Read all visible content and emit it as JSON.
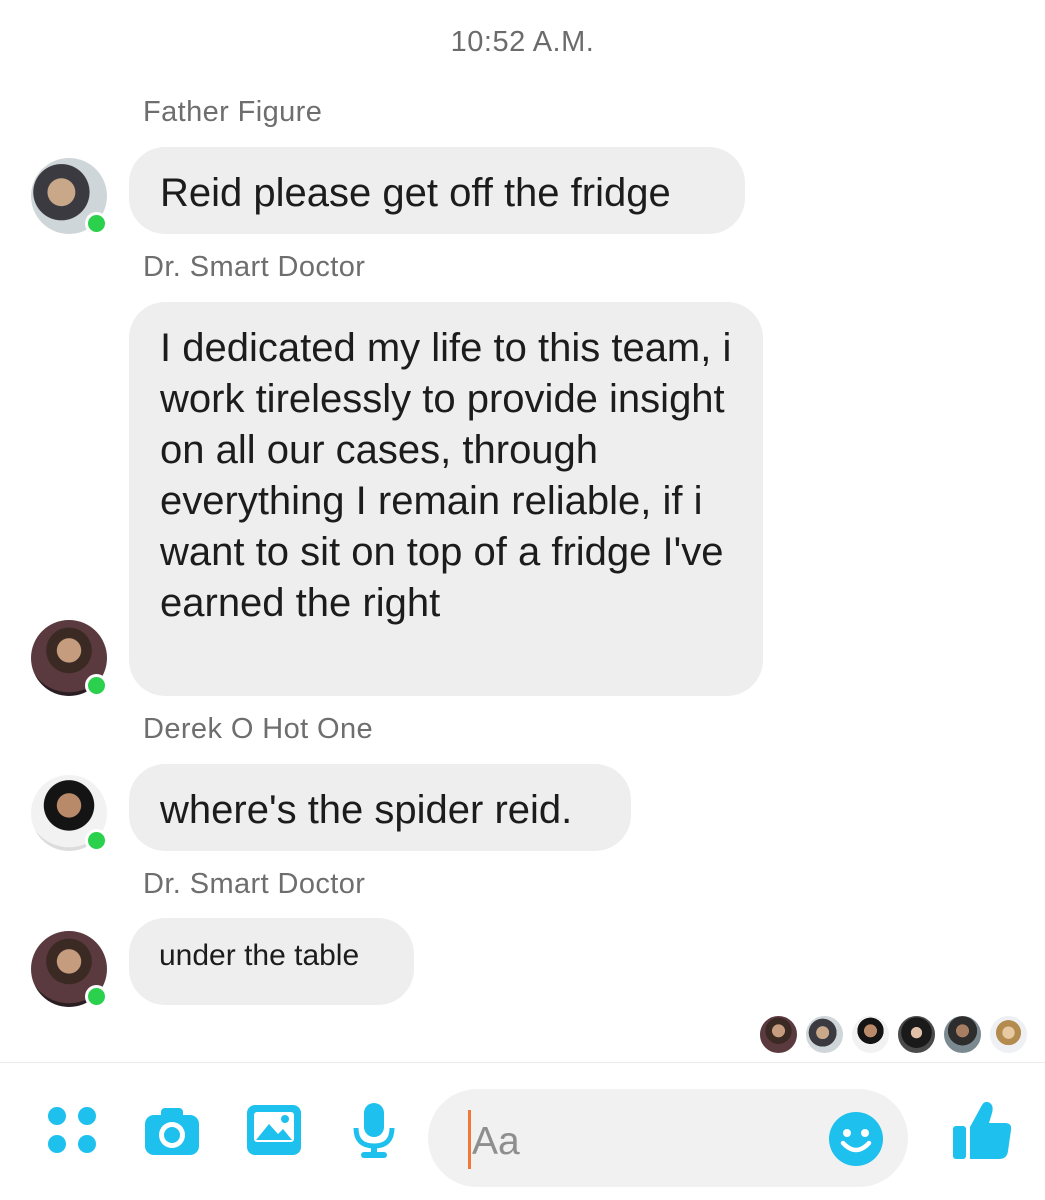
{
  "thread": {
    "timestamp": "10:52 A.M."
  },
  "messages": [
    {
      "sender": "Father Figure",
      "text": "Reid please get off the fridge"
    },
    {
      "sender": "Dr. Smart Doctor",
      "text": "I dedicated my life to this team, i work tirelessly to provide insight on all our cases, through everything I remain reliable, if i want to sit on top of a fridge I've earned the right"
    },
    {
      "sender": "Derek O Hot One",
      "text": "where's the spider reid."
    },
    {
      "sender": "Dr. Smart Doctor",
      "text": "under the table"
    }
  ],
  "composer": {
    "placeholder": "Aa",
    "icons": [
      "apps-icon",
      "camera-icon",
      "gallery-icon",
      "microphone-icon",
      "emoji-icon",
      "thumbs-up-icon"
    ]
  },
  "colors": {
    "accent": "#1ec0ee",
    "bubble": "#eeeeee",
    "online": "#2bd14c",
    "cursor": "#f07b37"
  }
}
